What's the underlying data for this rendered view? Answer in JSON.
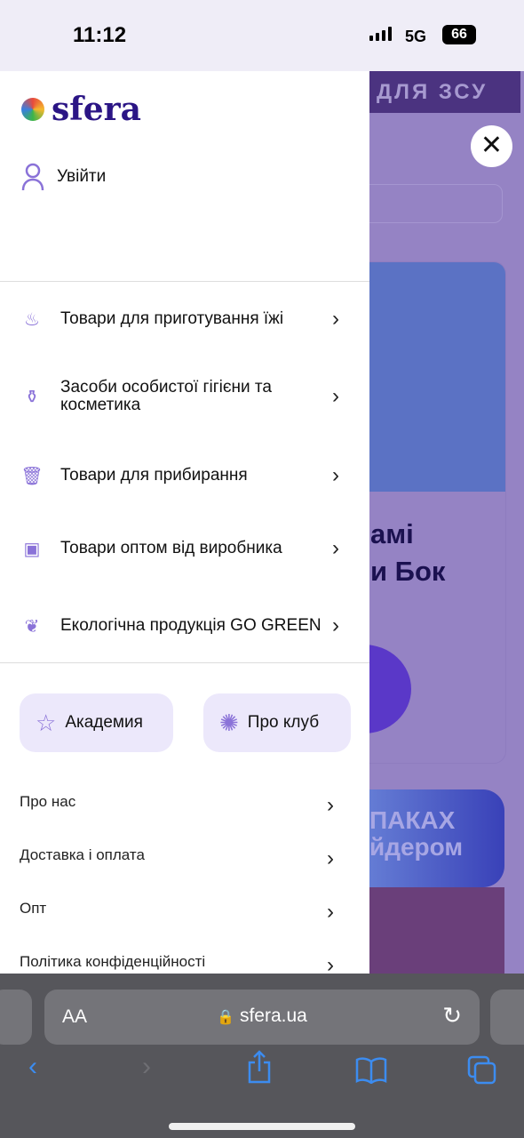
{
  "status_bar": {
    "time": "11:12",
    "network": "5G",
    "battery": "66"
  },
  "background": {
    "banner": "ДЛЯ ЗСУ",
    "card_title": "амі\nи Бок",
    "promo": "ПАКАХ\nйдером"
  },
  "drawer": {
    "logo": "sfera",
    "login": "Увійти",
    "categories": [
      {
        "label": "Товари для приготування їжі",
        "icon": "chef-hat-icon"
      },
      {
        "label": "Засоби особистої гігієни та косметика",
        "icon": "cosmetics-icon"
      },
      {
        "label": "Товари для прибирання",
        "icon": "bucket-icon"
      },
      {
        "label": "Товари оптом від виробника",
        "icon": "box-icon"
      },
      {
        "label": "Екологічна продукція GO GREEN",
        "icon": "leaf-icon"
      }
    ],
    "pills": [
      {
        "label": "Академия",
        "icon": "star-icon"
      },
      {
        "label": "Про клуб",
        "icon": "spiral-icon"
      }
    ],
    "links": [
      "Про нас",
      "Доставка і оплата",
      "Опт",
      "Політика конфіденційності"
    ]
  },
  "browser": {
    "text_size": "AA",
    "domain": "sfera.ua"
  },
  "colors": {
    "brand": "#2b1585",
    "accent": "#8a72d8",
    "safari_blue": "#3c8cf0"
  }
}
